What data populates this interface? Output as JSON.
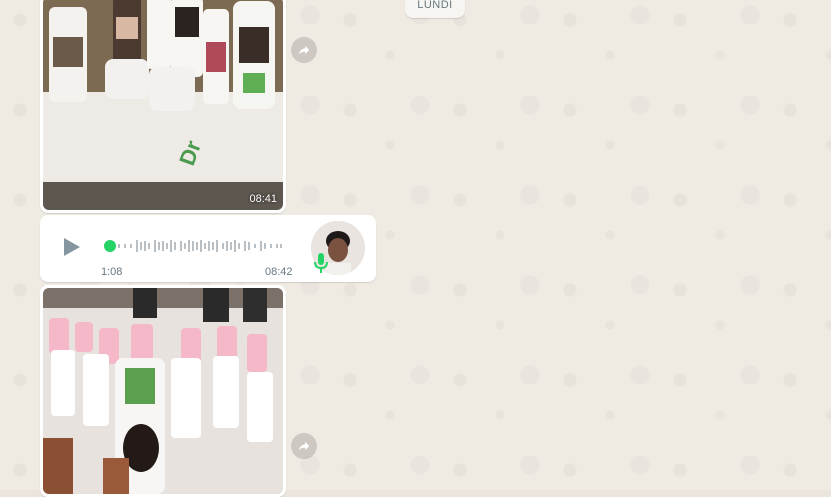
{
  "chat": {
    "day_label": "LUNDI",
    "messages": [
      {
        "type": "image",
        "time": "08:41"
      },
      {
        "type": "voice",
        "duration": "1:08",
        "time": "08:42"
      },
      {
        "type": "image",
        "time": ""
      }
    ]
  },
  "icons": {
    "forward": "forward-arrow",
    "play": "play-triangle",
    "mic": "microphone"
  },
  "colors": {
    "voice_dot": "#25d366",
    "mic": "#25d366",
    "meta_text": "#667781",
    "wallpaper": "#efeae2"
  }
}
